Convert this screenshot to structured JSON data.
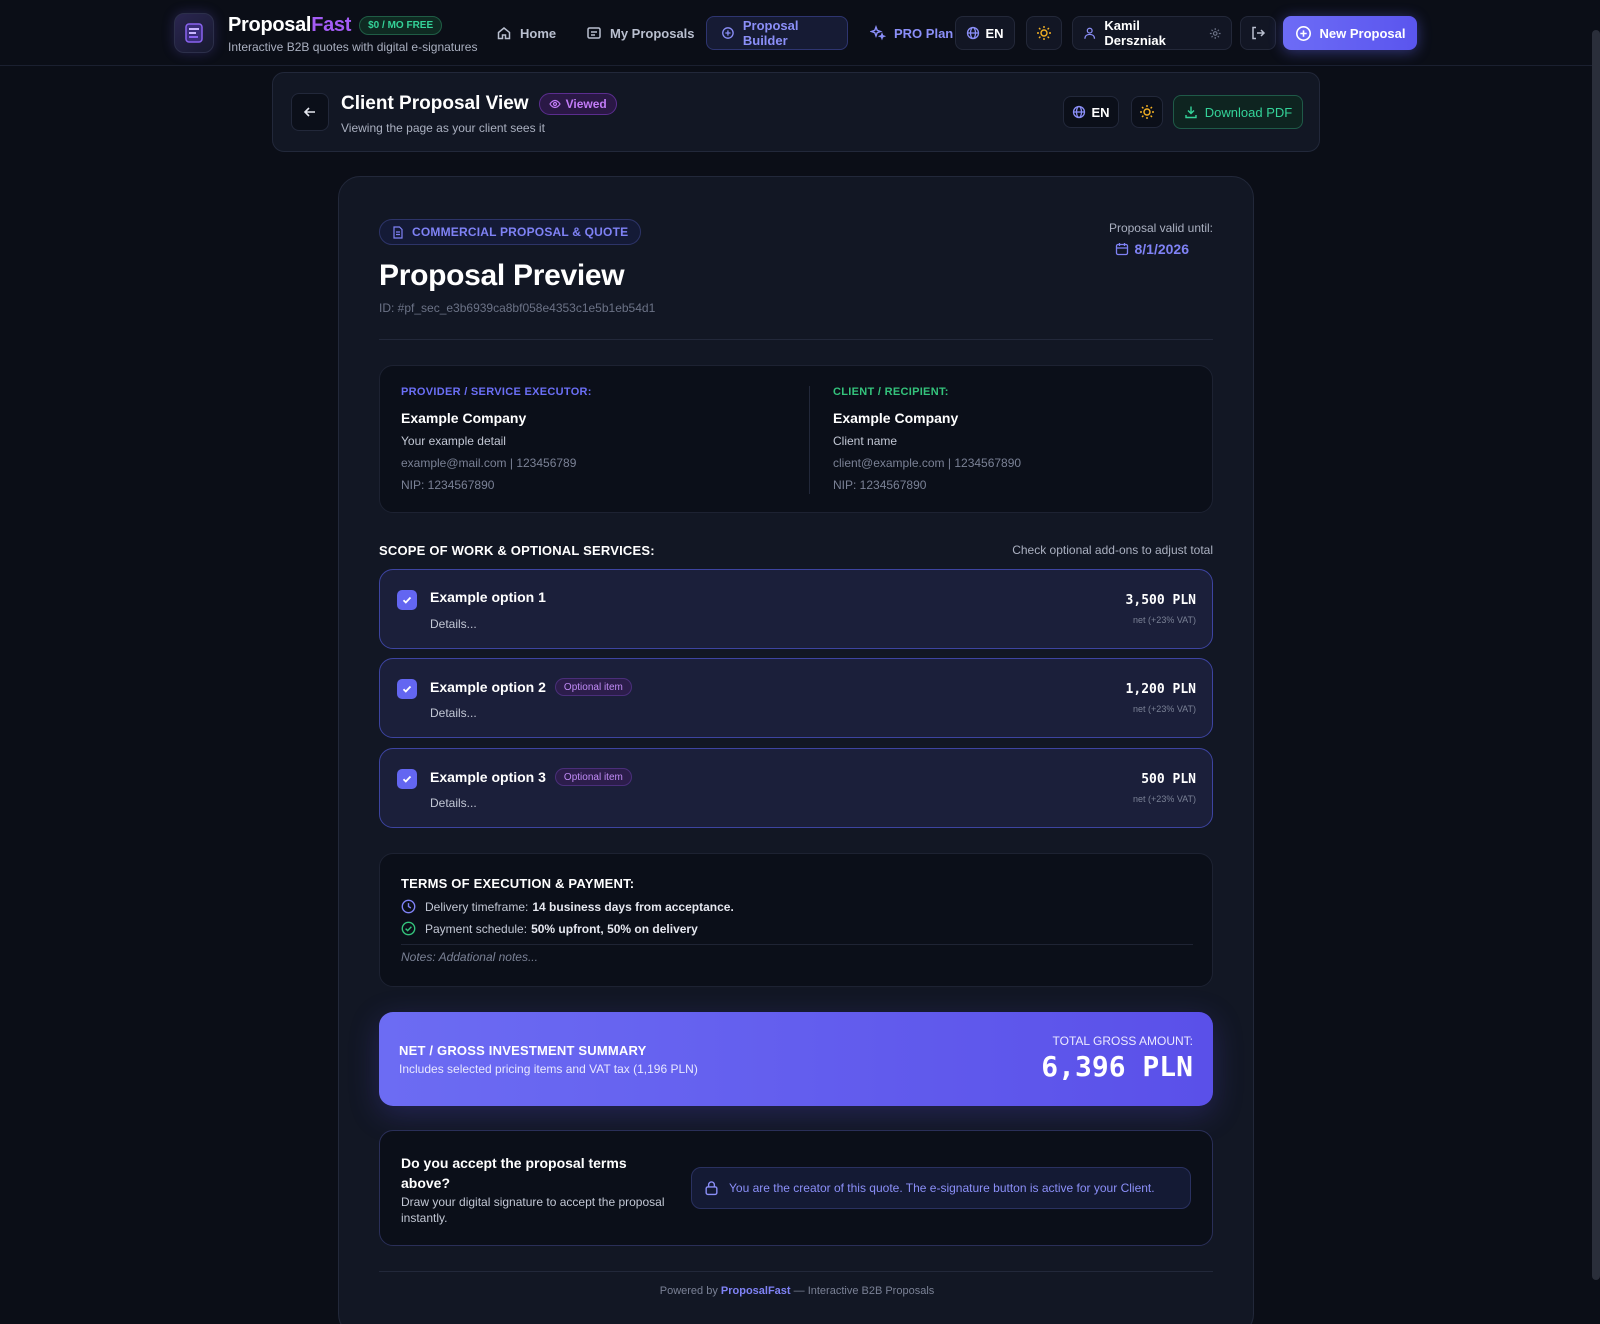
{
  "brand": {
    "name_main": "Proposal",
    "name_accent": "Fast",
    "free_badge": "$0 / MO FREE",
    "tagline": "Interactive B2B quotes with digital e-signatures"
  },
  "nav": {
    "home": "Home",
    "my_proposals": "My Proposals",
    "proposal_builder": "Proposal Builder",
    "pro_plan": "PRO Plan",
    "language": "EN",
    "user_name": "Kamil Derszniak",
    "new_proposal": "New Proposal"
  },
  "view_header": {
    "title": "Client Proposal View",
    "status_badge": "Viewed",
    "subtitle": "Viewing the page as your client sees it",
    "language": "EN",
    "download_pdf": "Download PDF"
  },
  "proposal": {
    "doc_type": "COMMERCIAL PROPOSAL & QUOTE",
    "title": "Proposal Preview",
    "id": "ID: #pf_sec_e3b6939ca8bf058e4353c1e5b1eb54d1",
    "valid_label": "Proposal valid until:",
    "valid_date": "8/1/2026"
  },
  "provider": {
    "heading": "PROVIDER / SERVICE EXECUTOR:",
    "company": "Example Company",
    "detail": "Your example detail",
    "contact": "example@mail.com | 123456789",
    "nip": "NIP: 1234567890"
  },
  "client": {
    "heading": "CLIENT / RECIPIENT:",
    "company": "Example Company",
    "detail": "Client name",
    "contact": "client@example.com | 1234567890",
    "nip": "NIP: 1234567890"
  },
  "scope": {
    "heading": "SCOPE OF WORK & OPTIONAL SERVICES:",
    "hint": "Check optional add-ons to adjust total",
    "items": [
      {
        "title": "Example option 1",
        "badge": "",
        "details": "Details...",
        "price": "3,500 PLN",
        "vat": "net (+23% VAT)",
        "checked": true
      },
      {
        "title": "Example option 2",
        "badge": "Optional item",
        "details": "Details...",
        "price": "1,200 PLN",
        "vat": "net (+23% VAT)",
        "checked": true
      },
      {
        "title": "Example option 3",
        "badge": "Optional item",
        "details": "Details...",
        "price": "500 PLN",
        "vat": "net (+23% VAT)",
        "checked": true
      }
    ]
  },
  "terms": {
    "heading": "TERMS OF EXECUTION & PAYMENT:",
    "delivery_label": "Delivery timeframe:",
    "delivery_value": "14 business days from acceptance.",
    "payment_label": "Payment schedule:",
    "payment_value": "50% upfront, 50% on delivery",
    "notes": "Notes: Addational notes..."
  },
  "summary": {
    "heading": "NET / GROSS INVESTMENT SUMMARY",
    "subtitle": "Includes selected pricing items and VAT tax (1,196 PLN)",
    "total_label": "TOTAL GROSS AMOUNT:",
    "total_value": "6,396 PLN"
  },
  "accept": {
    "question": "Do you accept the proposal terms above?",
    "instructions": "Draw your digital signature to accept the proposal instantly.",
    "creator_note": "You are the creator of this quote. The e-signature button is active for your Client."
  },
  "footer": {
    "powered_by": "Powered by",
    "brand": "ProposalFast",
    "suffix": "— Interactive B2B Proposals"
  },
  "colors": {
    "background": "#0b0e17",
    "accent": "#6366f1",
    "brand_accent": "#a45cf6",
    "success": "#34d399"
  }
}
